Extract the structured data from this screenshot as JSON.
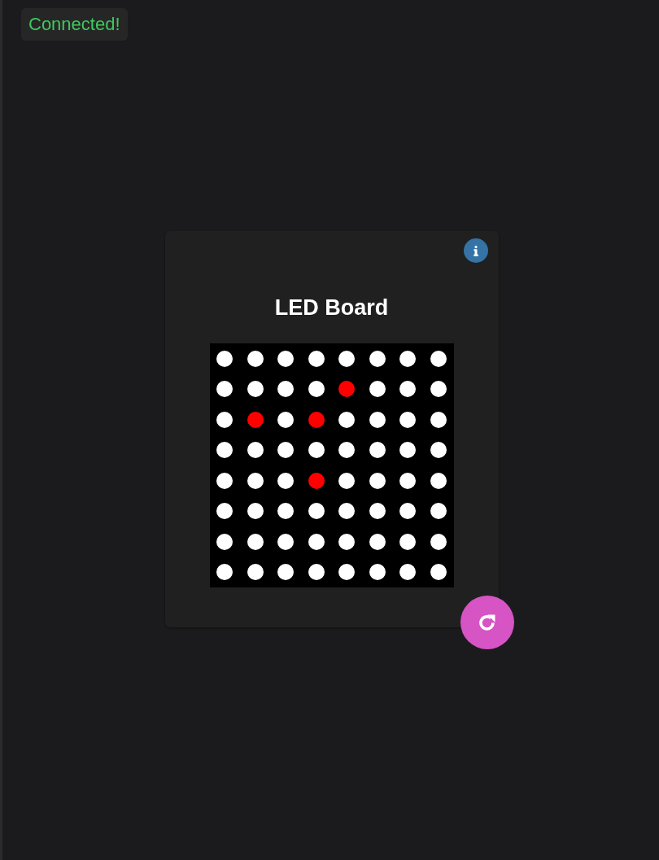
{
  "status": {
    "text": "Connected!"
  },
  "card": {
    "title": "LED Board",
    "board": {
      "rows": [
        {
          "cells": [
            {
              "color": "#ffffff"
            },
            {
              "color": "#ffffff"
            },
            {
              "color": "#ffffff"
            },
            {
              "color": "#ffffff"
            },
            {
              "color": "#ffffff"
            },
            {
              "color": "#ffffff"
            },
            {
              "color": "#ffffff"
            },
            {
              "color": "#ffffff"
            }
          ]
        },
        {
          "cells": [
            {
              "color": "#ffffff"
            },
            {
              "color": "#ffffff"
            },
            {
              "color": "#ffffff"
            },
            {
              "color": "#ffffff"
            },
            {
              "color": "#ff0000"
            },
            {
              "color": "#ffffff"
            },
            {
              "color": "#ffffff"
            },
            {
              "color": "#ffffff"
            }
          ]
        },
        {
          "cells": [
            {
              "color": "#ffffff"
            },
            {
              "color": "#ff0000"
            },
            {
              "color": "#ffffff"
            },
            {
              "color": "#ff0000"
            },
            {
              "color": "#ffffff"
            },
            {
              "color": "#ffffff"
            },
            {
              "color": "#ffffff"
            },
            {
              "color": "#ffffff"
            }
          ]
        },
        {
          "cells": [
            {
              "color": "#ffffff"
            },
            {
              "color": "#ffffff"
            },
            {
              "color": "#ffffff"
            },
            {
              "color": "#ffffff"
            },
            {
              "color": "#ffffff"
            },
            {
              "color": "#ffffff"
            },
            {
              "color": "#ffffff"
            },
            {
              "color": "#ffffff"
            }
          ]
        },
        {
          "cells": [
            {
              "color": "#ffffff"
            },
            {
              "color": "#ffffff"
            },
            {
              "color": "#ffffff"
            },
            {
              "color": "#ff0000"
            },
            {
              "color": "#ffffff"
            },
            {
              "color": "#ffffff"
            },
            {
              "color": "#ffffff"
            },
            {
              "color": "#ffffff"
            }
          ]
        },
        {
          "cells": [
            {
              "color": "#ffffff"
            },
            {
              "color": "#ffffff"
            },
            {
              "color": "#ffffff"
            },
            {
              "color": "#ffffff"
            },
            {
              "color": "#ffffff"
            },
            {
              "color": "#ffffff"
            },
            {
              "color": "#ffffff"
            },
            {
              "color": "#ffffff"
            }
          ]
        },
        {
          "cells": [
            {
              "color": "#ffffff"
            },
            {
              "color": "#ffffff"
            },
            {
              "color": "#ffffff"
            },
            {
              "color": "#ffffff"
            },
            {
              "color": "#ffffff"
            },
            {
              "color": "#ffffff"
            },
            {
              "color": "#ffffff"
            },
            {
              "color": "#ffffff"
            }
          ]
        },
        {
          "cells": [
            {
              "color": "#ffffff"
            },
            {
              "color": "#ffffff"
            },
            {
              "color": "#ffffff"
            },
            {
              "color": "#ffffff"
            },
            {
              "color": "#ffffff"
            },
            {
              "color": "#ffffff"
            },
            {
              "color": "#ffffff"
            },
            {
              "color": "#ffffff"
            }
          ]
        }
      ]
    }
  }
}
